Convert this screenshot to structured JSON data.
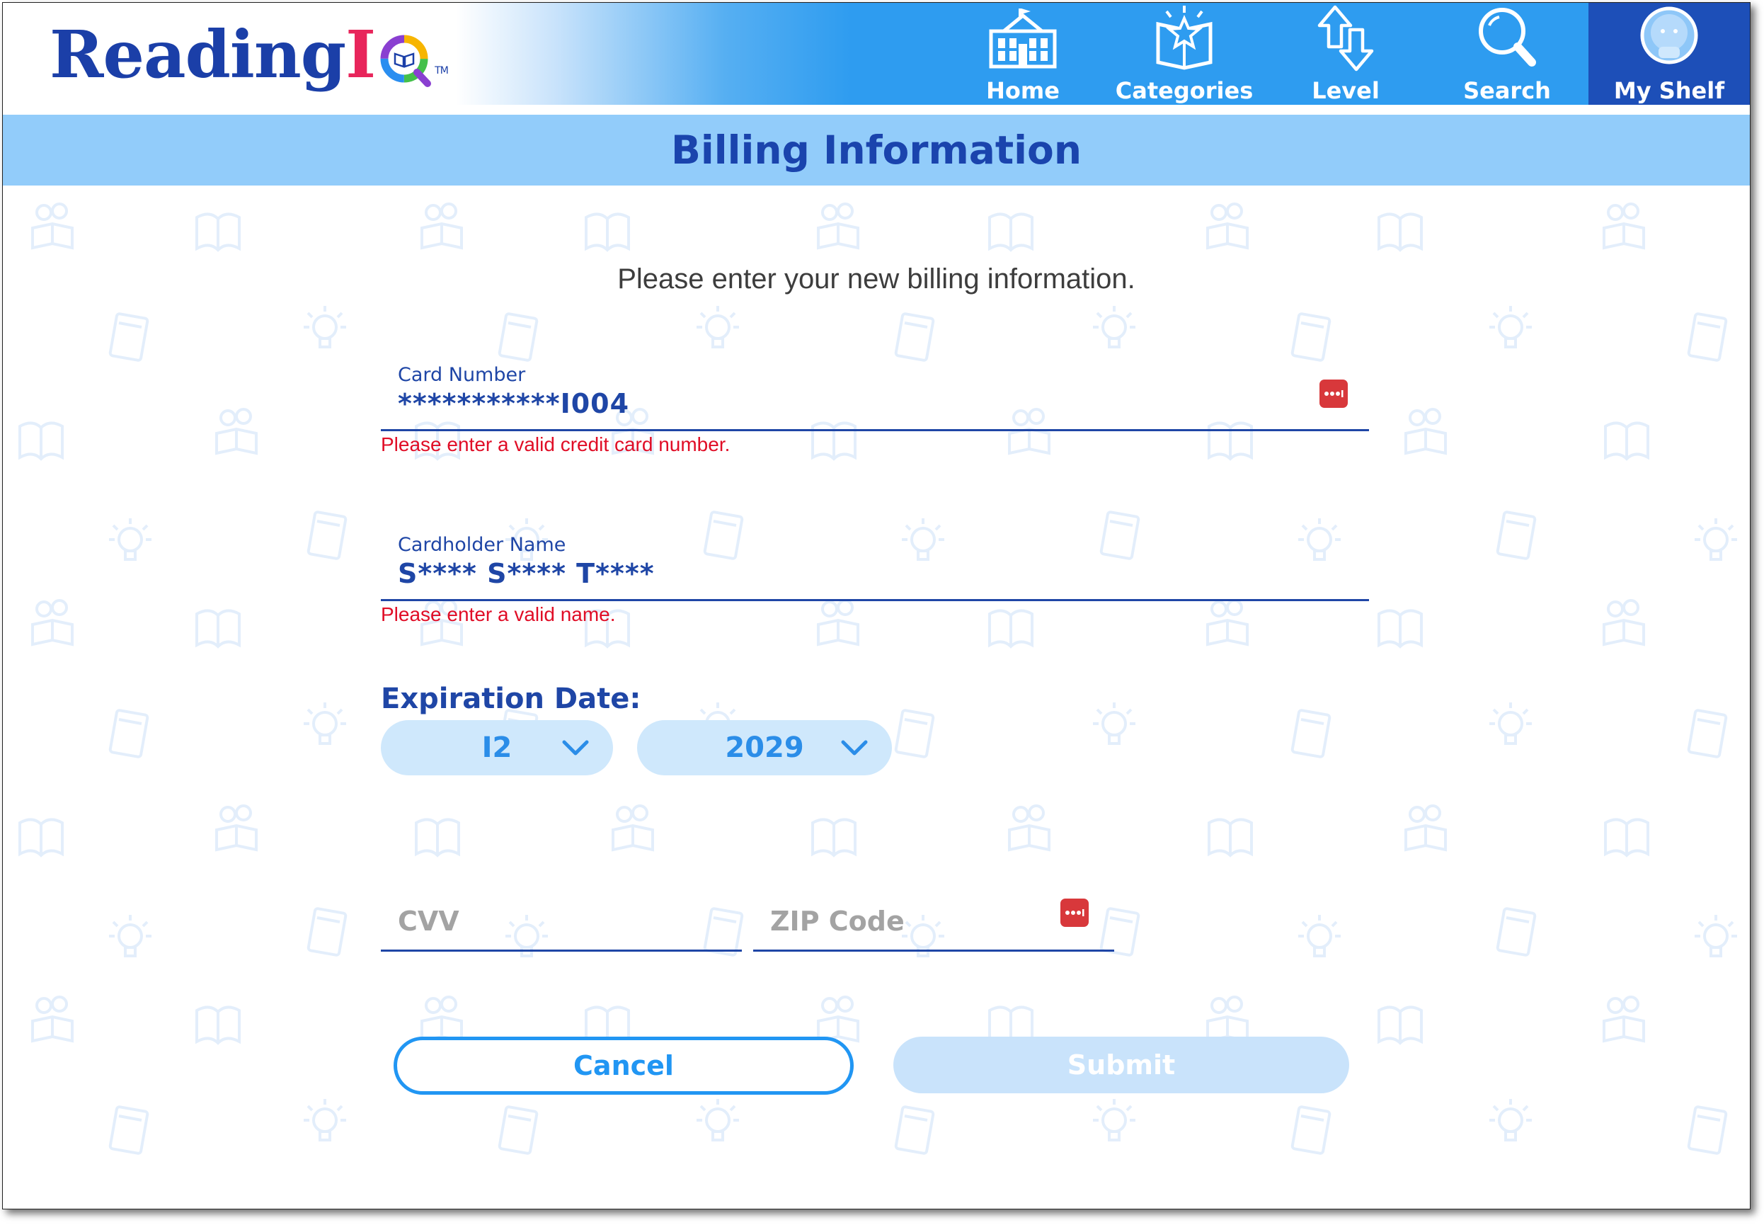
{
  "brand": {
    "logo_text_main": "Reading",
    "logo_text_i": "I",
    "logo_text_q": "Q",
    "logo_tm": "TM",
    "color_primary": "#1b3fa8",
    "color_accent": "#2e9cf0"
  },
  "nav": {
    "items": [
      {
        "label": "Home",
        "icon": "school-building-icon"
      },
      {
        "label": "Categories",
        "icon": "star-book-icon"
      },
      {
        "label": "Level",
        "icon": "up-down-arrows-icon"
      },
      {
        "label": "Search",
        "icon": "magnifier-icon"
      },
      {
        "label": "My Shelf",
        "icon": "avatar-icon",
        "active": true
      }
    ]
  },
  "page": {
    "title": "Billing Information",
    "intro": "Please enter your new billing information."
  },
  "form": {
    "card_number": {
      "label": "Card Number",
      "value": "***********I004",
      "error": "Please enter a valid credit card number."
    },
    "cardholder_name": {
      "label": "Cardholder Name",
      "value": "S**** S**** T****",
      "error": "Please enter a valid name."
    },
    "expiration": {
      "label": "Expiration Date:",
      "month": "I2",
      "year": "2029"
    },
    "cvv": {
      "placeholder": "CVV"
    },
    "zip": {
      "placeholder": "ZIP Code"
    },
    "buttons": {
      "cancel": "Cancel",
      "submit": "Submit"
    },
    "error_color": "#e00d26"
  }
}
